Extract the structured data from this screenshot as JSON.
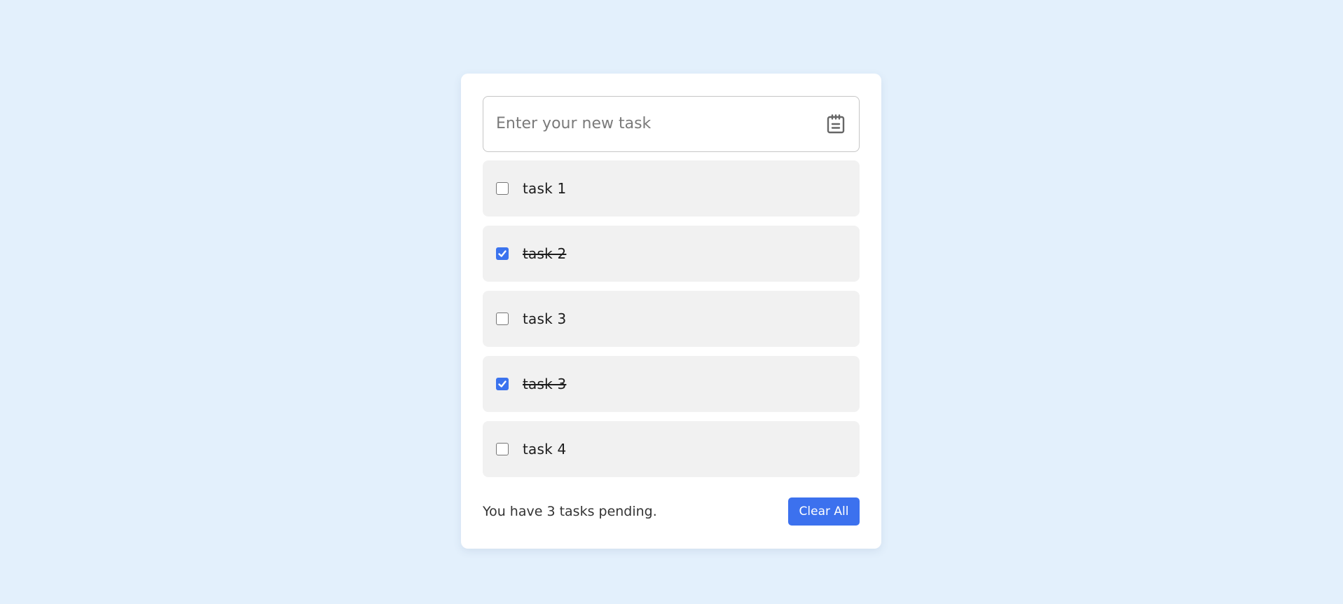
{
  "input": {
    "placeholder": "Enter your new task",
    "value": "",
    "icon": "notepad-icon"
  },
  "tasks": [
    {
      "label": "task 1",
      "completed": false
    },
    {
      "label": "task 2",
      "completed": true
    },
    {
      "label": "task 3",
      "completed": false
    },
    {
      "label": "task 3",
      "completed": true
    },
    {
      "label": "task 4",
      "completed": false
    }
  ],
  "footer": {
    "pending_text": "You have 3 tasks pending.",
    "clear_label": "Clear All"
  },
  "colors": {
    "background": "#e3f0fc",
    "accent": "#3c71ee",
    "task_bg": "#f1f1f1"
  }
}
